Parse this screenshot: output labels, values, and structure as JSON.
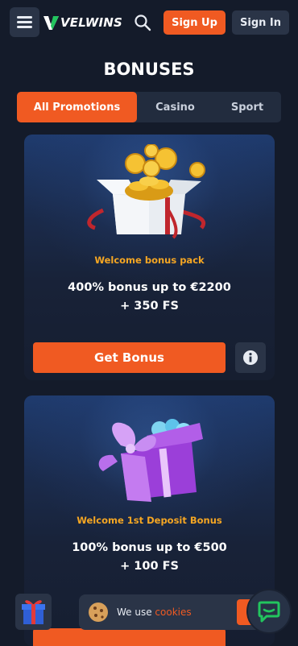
{
  "header": {
    "logo_text": "VELWINS",
    "signup_label": "Sign Up",
    "signin_label": "Sign In"
  },
  "page_title": "BONUSES",
  "tabs": [
    {
      "label": "All Promotions",
      "active": true
    },
    {
      "label": "Casino",
      "active": false
    },
    {
      "label": "Sport",
      "active": false
    }
  ],
  "cards": [
    {
      "image": "gift-box-with-gold-coins",
      "subtitle": "Welcome bonus pack",
      "headline_line1": "400% bonus up to €2200",
      "headline_line2": "+ 350 FS",
      "button_label": "Get Bonus"
    },
    {
      "image": "purple-gift-box-with-gems",
      "subtitle": "Welcome 1st Deposit Bonus",
      "headline_line1": "100% bonus up to €500",
      "headline_line2": "+ 100 FS"
    }
  ],
  "cookie": {
    "text": "We use ",
    "link": "cookies"
  },
  "colors": {
    "accent": "#f05a22",
    "background": "#141b2a",
    "subtitle": "#f5a623",
    "chat_green": "#22c55e"
  }
}
